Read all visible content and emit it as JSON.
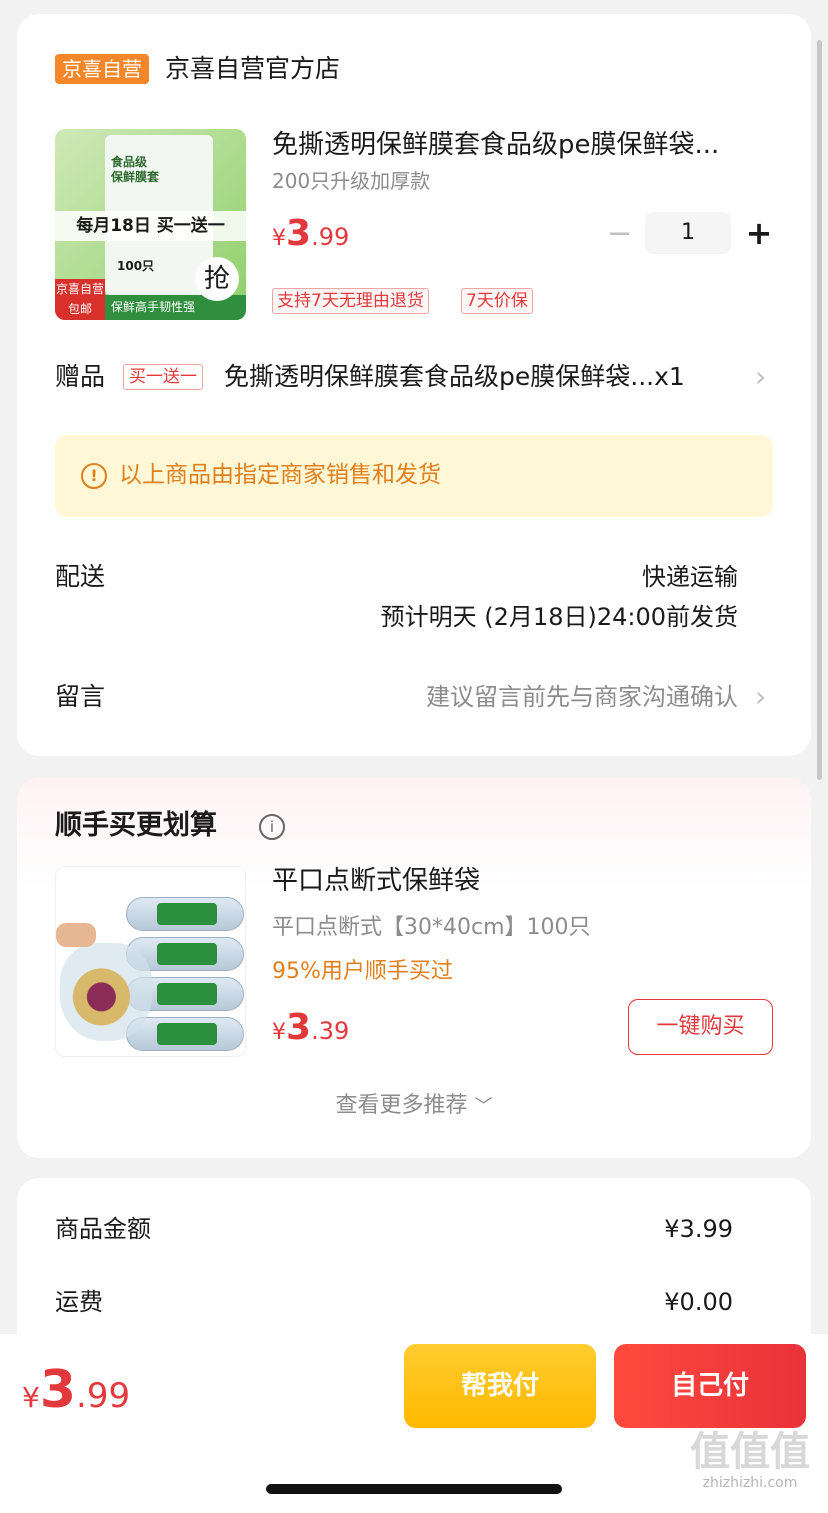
{
  "shop": {
    "badge": "京喜自营",
    "name": "京喜自营官方店"
  },
  "product": {
    "image": {
      "pack_text": "食品级\n保鲜膜套",
      "promo": "每月18日 买一送一",
      "count": "100只",
      "badge_top": "京喜自营",
      "badge_bottom": "包邮",
      "strip": "保鲜高手韧性强",
      "grab": "抢"
    },
    "title": "免撕透明保鲜膜套食品级pe膜保鲜袋...",
    "spec": "200只升级加厚款",
    "price": {
      "currency": "¥",
      "integer": "3",
      "decimal": ".99"
    },
    "quantity": "1",
    "tags": [
      "支持7天无理由退货",
      "7天价保"
    ]
  },
  "gift": {
    "label": "赠品",
    "tag": "买一送一",
    "text": "免撕透明保鲜膜套食品级pe膜保鲜袋...x1"
  },
  "notice": {
    "text": "以上商品由指定商家销售和发货"
  },
  "delivery": {
    "label": "配送",
    "method": "快递运输",
    "estimate": "预计明天 (2月18日)24:00前发货"
  },
  "message": {
    "label": "留言",
    "placeholder": "建议留言前先与商家沟通确认"
  },
  "recommend": {
    "title": "顺手买更划算",
    "item": {
      "name": "平口点断式保鲜袋",
      "spec": "平口点断式【30*40cm】100只",
      "social": "95%用户顺手买过",
      "price": {
        "currency": "¥",
        "integer": "3",
        "decimal": ".39"
      },
      "buy_label": "一键购买"
    },
    "more": "查看更多推荐"
  },
  "summary": {
    "rows": [
      {
        "label": "商品金额",
        "value": "¥3.99"
      },
      {
        "label": "运费",
        "value": "¥0.00"
      }
    ]
  },
  "bottom": {
    "total": {
      "currency": "¥",
      "integer": "3",
      "decimal": ".99"
    },
    "pay_friend": "帮我付",
    "pay_self": "自己付"
  },
  "watermark": {
    "logo": "值值值",
    "site": "zhizhizhi.com"
  },
  "colors": {
    "accent_red": "#e4393c",
    "orange": "#f5872a",
    "notice_bg": "#fff7d6",
    "yellow_button": "#ffbf1a"
  }
}
